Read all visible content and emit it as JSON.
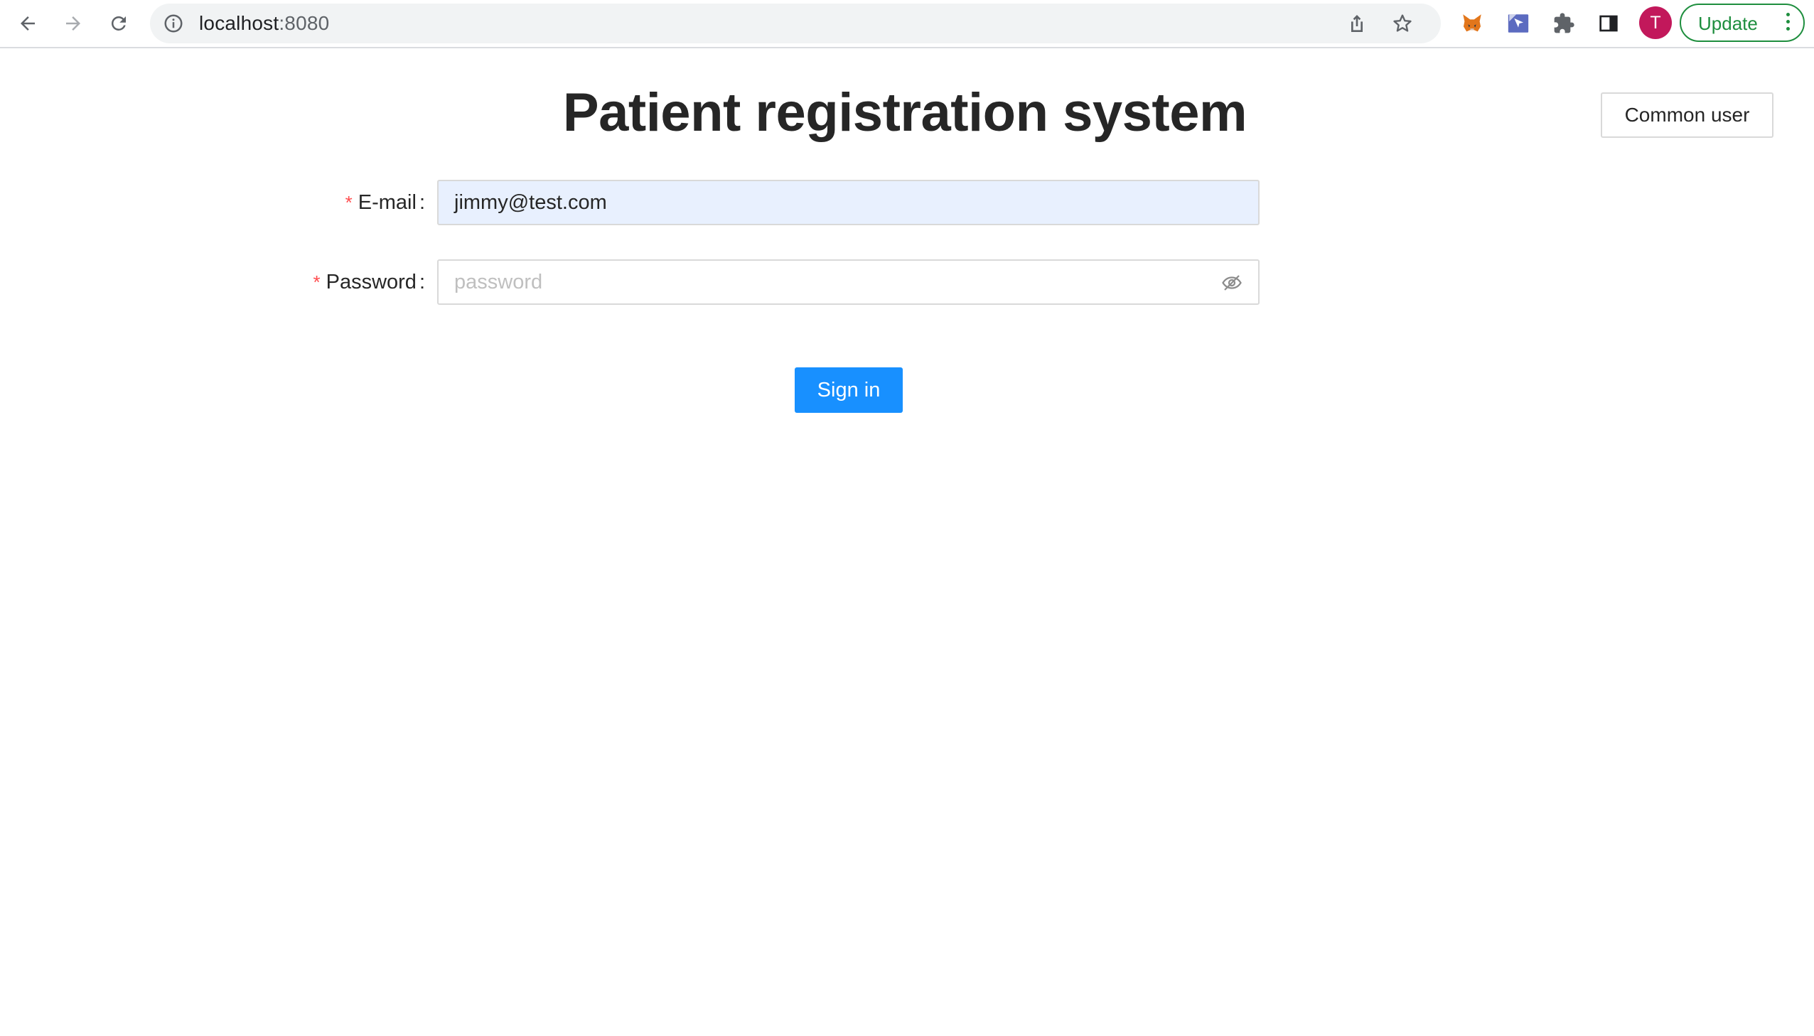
{
  "browser": {
    "url_host": "localhost",
    "url_port": ":8080",
    "profile_initial": "T",
    "update_label": "Update"
  },
  "page": {
    "title": "Patient registration system",
    "role_button_label": "Common user"
  },
  "form": {
    "email": {
      "required_mark": "*",
      "label": "E-mail",
      "colon": ":",
      "value": "jimmy@test.com"
    },
    "password": {
      "required_mark": "*",
      "label": "Password",
      "colon": ":",
      "value": "",
      "placeholder": "password"
    },
    "submit_label": "Sign in"
  },
  "colors": {
    "primary": "#1890ff",
    "required": "#ff4d4f",
    "autofill_bg": "#e8f0fe",
    "update_green": "#1e8e3e",
    "avatar": "#c2185b"
  },
  "icons": {
    "back": "back-arrow-icon",
    "forward": "forward-arrow-icon",
    "reload": "reload-icon",
    "site_info": "info-icon",
    "share": "share-icon",
    "bookmark": "star-icon",
    "metamask": "fox-extension-icon",
    "extension2": "cursor-extension-icon",
    "extensions": "puzzle-icon",
    "side_panel": "side-panel-icon",
    "password_toggle": "eye-invisible-icon"
  }
}
